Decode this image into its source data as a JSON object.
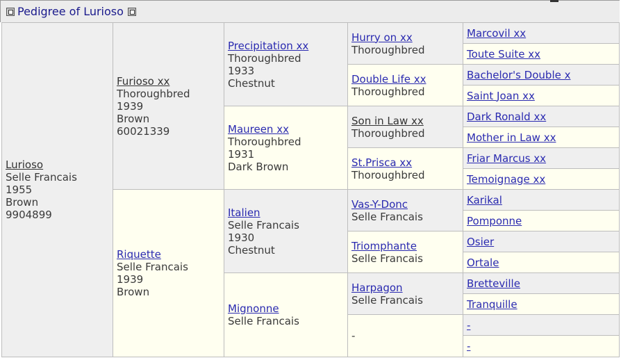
{
  "header": {
    "title": "Pedigree of Lurioso"
  },
  "subject": {
    "name": "Lurioso",
    "breed": "Selle Francais",
    "year": "1955",
    "color": "Brown",
    "id": "9904899"
  },
  "g1": [
    {
      "name": "Furioso xx",
      "breed": "Thoroughbred",
      "year": "1939",
      "color": "Brown",
      "id": "60021339"
    },
    {
      "name": "Riquette",
      "breed": "Selle Francais",
      "year": "1939",
      "color": "Brown"
    }
  ],
  "g2": [
    {
      "name": "Precipitation xx",
      "breed": "Thoroughbred",
      "year": "1933",
      "color": "Chestnut"
    },
    {
      "name": "Maureen xx",
      "breed": "Thoroughbred",
      "year": "1931",
      "color": "Dark Brown"
    },
    {
      "name": "Italien",
      "breed": "Selle Francais",
      "year": "1930",
      "color": "Chestnut"
    },
    {
      "name": "Mignonne",
      "breed": "Selle Francais"
    }
  ],
  "g3": [
    {
      "name": "Hurry on xx",
      "breed": "Thoroughbred"
    },
    {
      "name": "Double Life xx",
      "breed": "Thoroughbred"
    },
    {
      "name": "Son in Law xx",
      "breed": "Thoroughbred"
    },
    {
      "name": "St.Prisca xx",
      "breed": "Thoroughbred"
    },
    {
      "name": "Vas-Y-Donc",
      "breed": "Selle Francais"
    },
    {
      "name": "Triomphante",
      "breed": "Selle Francais"
    },
    {
      "name": "Harpagon",
      "breed": "Selle Francais"
    },
    {
      "name": "-"
    }
  ],
  "g4": [
    "Marcovil xx",
    "Toute Suite xx",
    "Bachelor's Double x",
    "Saint Joan xx",
    "Dark Ronald xx",
    "Mother in Law xx",
    "Friar Marcus xx",
    "Temoignage xx",
    "Karikal",
    "Pomponne",
    "Osier",
    "Ortale",
    "Bretteville",
    "Tranquille",
    "-",
    "-"
  ]
}
